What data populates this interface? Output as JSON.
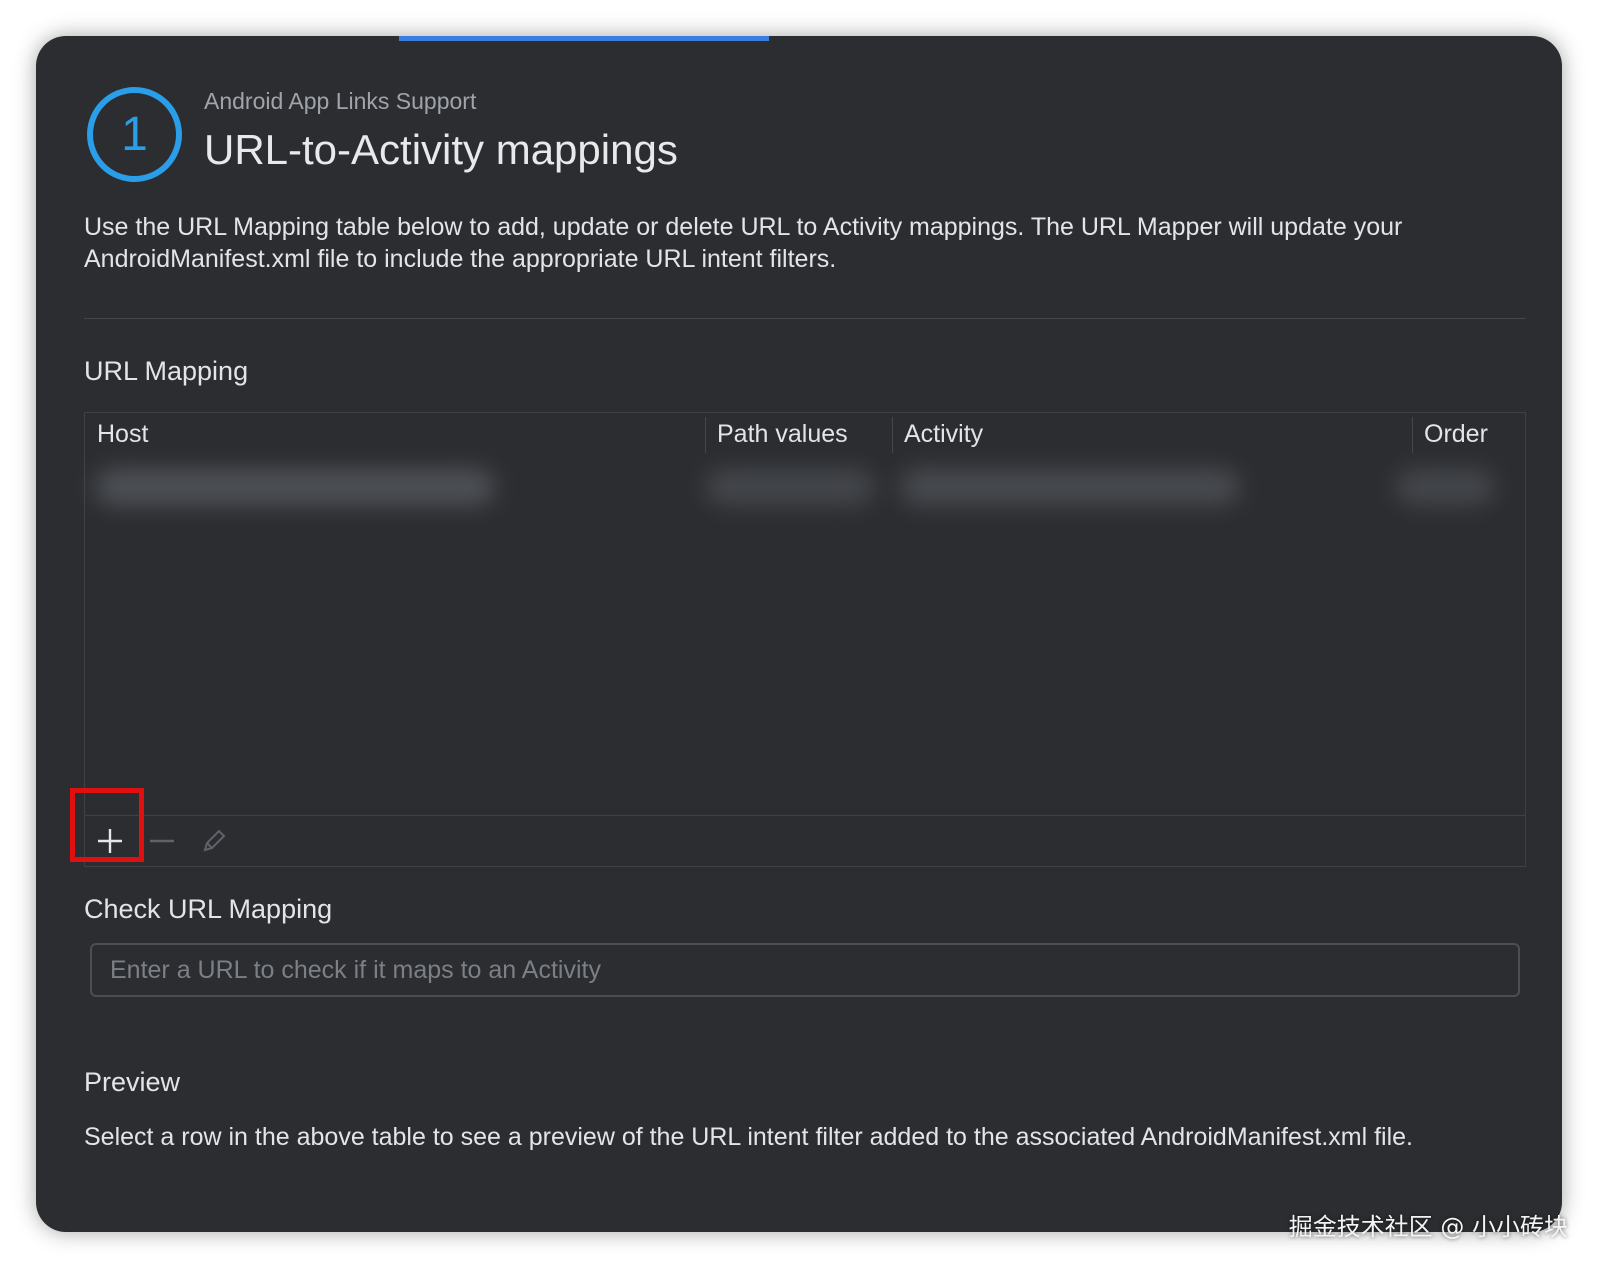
{
  "header": {
    "step_number": "1",
    "subtitle": "Android App Links Support",
    "title": "URL-to-Activity mappings"
  },
  "description": "Use the URL Mapping table below to add, update or delete URL to Activity mappings. The URL Mapper will update your AndroidManifest.xml file to include the appropriate URL intent filters.",
  "url_mapping": {
    "section_label": "URL Mapping",
    "columns": [
      "Host",
      "Path values",
      "Activity",
      "Order"
    ],
    "toolbar": {
      "add_icon": "plus-icon",
      "remove_icon": "minus-icon",
      "edit_icon": "pencil-icon"
    }
  },
  "check_url": {
    "section_label": "Check URL Mapping",
    "placeholder": "Enter a URL to check if it maps to an Activity",
    "value": ""
  },
  "preview": {
    "section_label": "Preview",
    "text": "Select a row in the above table to see a preview of the URL intent filter added to the associated AndroidManifest.xml file."
  },
  "watermark": "掘金技术社区 @ 小小砖块",
  "colors": {
    "background": "#2b2d30",
    "accent": "#2a9ee8",
    "progress": "#3a7fe0",
    "highlight": "#e01010"
  }
}
